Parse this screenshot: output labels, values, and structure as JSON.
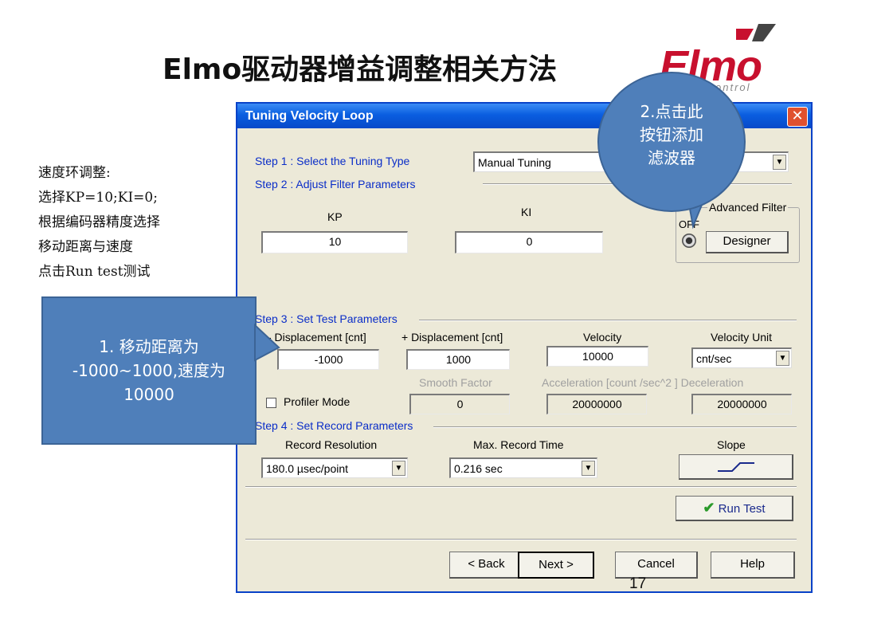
{
  "slide": {
    "title": "Elmo驱动器增益调整相关方法",
    "page_number": "17",
    "logo_text": "Elmo",
    "logo_subtext": "ontrol",
    "side_note_lines": [
      "速度环调整:",
      "选择KP=10;KI=0;",
      "根据编码器精度选择",
      "移动距离与速度",
      "点击Run test测试"
    ]
  },
  "callouts": {
    "displacement_lines": [
      "1. 移动距离为",
      "-1000~1000,速度为",
      "10000"
    ],
    "filter_lines": [
      "2.点击此",
      "按钮添加",
      "滤波器"
    ]
  },
  "dialog": {
    "title": "Tuning Velocity Loop",
    "close_glyph": "✕",
    "step1_label": "Step 1 : Select the  Tuning Type",
    "tuning_type": "Manual Tuning",
    "step2_label": "Step 2 :  Adjust Filter Parameters",
    "kp_label": "KP",
    "kp_value": "10",
    "ki_label": "KI",
    "ki_value": "0",
    "advanced_filter_label": "Advanced Filter",
    "off_label": "OFF",
    "designer_button": "Designer",
    "step3_label": "Step 3 : Set Test  Parameters",
    "neg_disp_label": "- Displacement [cnt]",
    "neg_disp_value": "-1000",
    "pos_disp_label": "+ Displacement [cnt]",
    "pos_disp_value": "1000",
    "velocity_label": "Velocity",
    "velocity_value": "10000",
    "velocity_unit_label": "Velocity Unit",
    "velocity_unit_value": "cnt/sec",
    "smooth_factor_label": "Smooth Factor",
    "smooth_factor_value": "0",
    "acceleration_label": "Acceleration   [count /sec^2 ]  Deceleration",
    "acceleration_value": "20000000",
    "deceleration_value": "20000000",
    "profiler_mode_label": "Profiler Mode",
    "step4_label": "Step 4 : Set Record Parameters",
    "record_resolution_label": "Record Resolution",
    "record_resolution_value": "180.0 µsec/point",
    "max_record_time_label": "Max. Record Time",
    "max_record_time_value": "0.216 sec",
    "slope_label": "Slope",
    "run_test_button": "Run Test",
    "back_button": "< Back",
    "next_button": "Next >",
    "cancel_button": "Cancel",
    "help_button": "Help"
  },
  "colors": {
    "callout_fill": "#4f7fba",
    "titlebar": "#0a5ee0",
    "step_text": "#0a2dc8",
    "logo_red": "#c8102e"
  }
}
